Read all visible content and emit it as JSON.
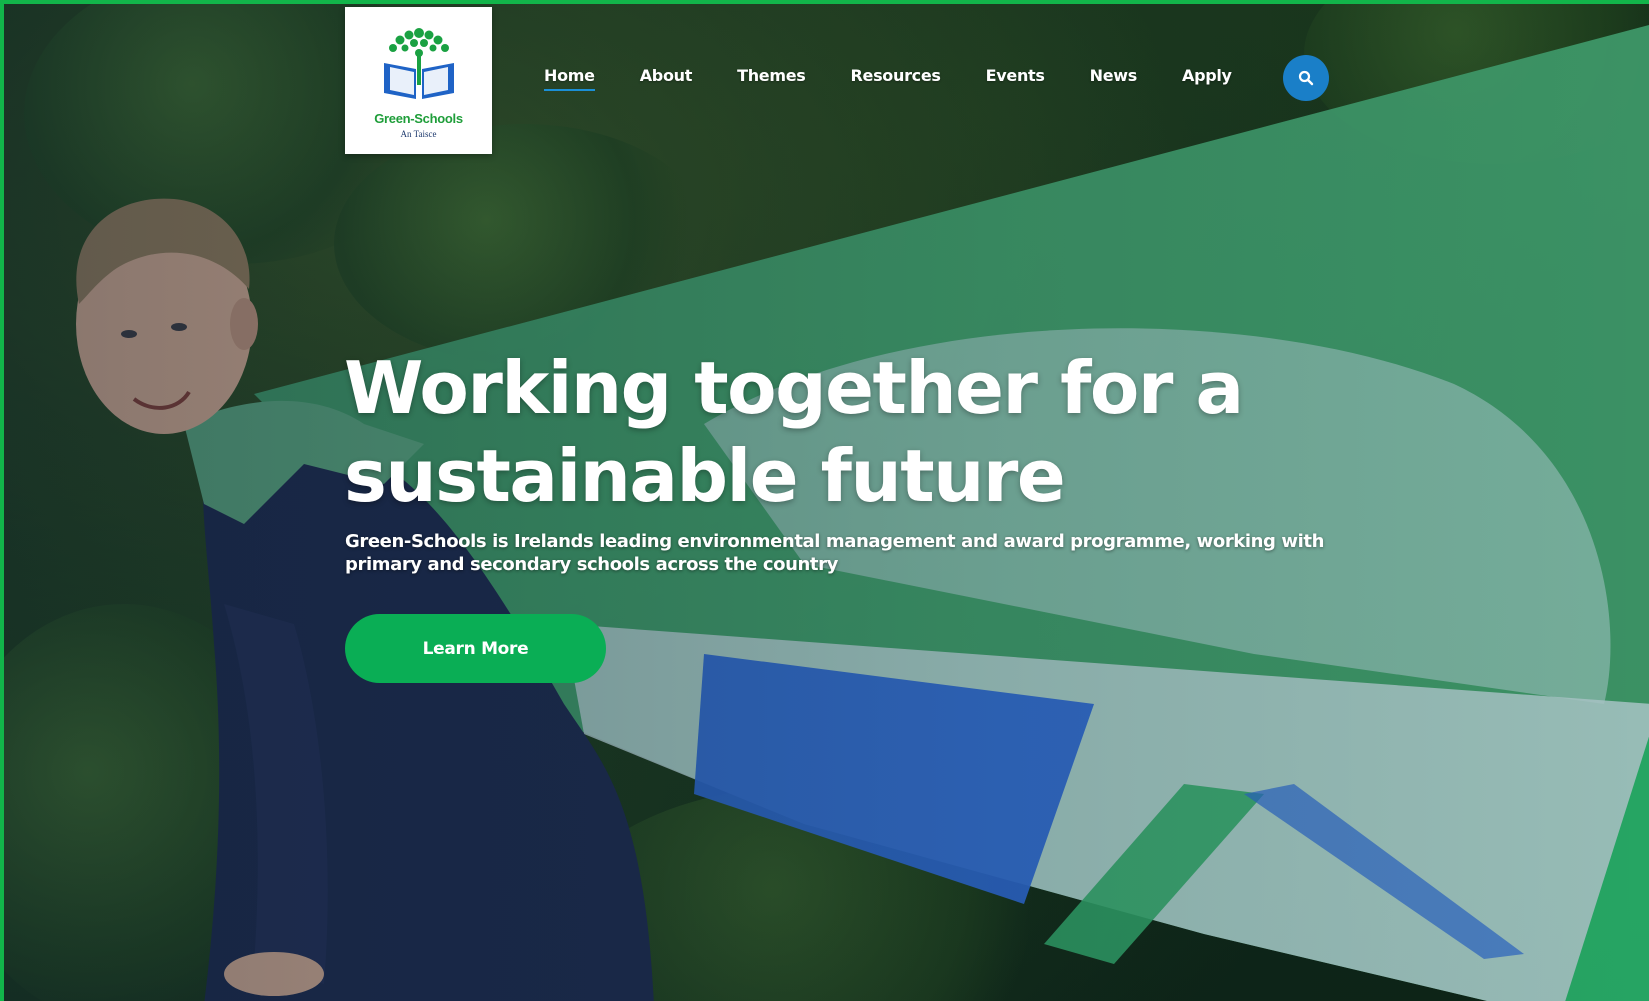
{
  "brand": {
    "name": "Green-Schools",
    "sub": "An Taisce",
    "logo_icon": "tree-book-logo"
  },
  "nav": {
    "items": [
      {
        "label": "Home",
        "active": true
      },
      {
        "label": "About",
        "active": false
      },
      {
        "label": "Themes",
        "active": false
      },
      {
        "label": "Resources",
        "active": false
      },
      {
        "label": "Events",
        "active": false
      },
      {
        "label": "News",
        "active": false
      },
      {
        "label": "Apply",
        "active": false
      }
    ],
    "search_icon": "search-icon"
  },
  "hero": {
    "title_line1": "Working together for a",
    "title_line2": "sustainable future",
    "subtitle_line1": "Green-Schools is Irelands leading environmental management and award programme, working with",
    "subtitle_line2": "primary and secondary schools across the country",
    "cta_label": "Learn More"
  },
  "colors": {
    "accent_green": "#0aae55",
    "accent_blue": "#1a7fc8",
    "frame_green": "#12b54a",
    "logo_green": "#1f9e3a"
  }
}
